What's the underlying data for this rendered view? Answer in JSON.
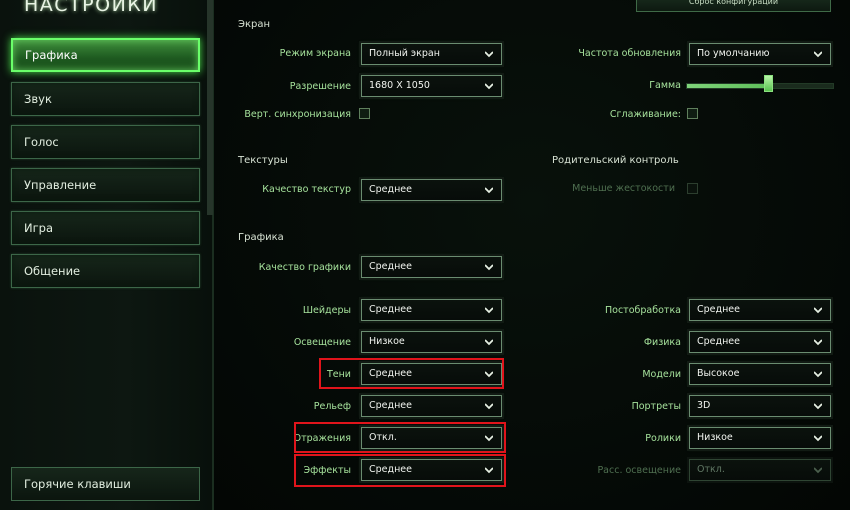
{
  "app": {
    "title": "НАСТРОЙКИ"
  },
  "nav": {
    "items": [
      {
        "label": "Графика",
        "active": true
      },
      {
        "label": "Звук"
      },
      {
        "label": "Голос"
      },
      {
        "label": "Управление"
      },
      {
        "label": "Игра"
      },
      {
        "label": "Общение"
      }
    ],
    "hotkeys_label": "Горячие клавиши"
  },
  "top_button": {
    "label": "Сброс конфигурации"
  },
  "screen": {
    "heading": "Экран",
    "mode_label": "Режим экрана",
    "mode_value": "Полный экран",
    "resolution_label": "Разрешение",
    "resolution_value": "1680 X 1050",
    "vsync_label": "Верт. синхронизация",
    "refresh_label": "Частота обновления",
    "refresh_value": "По умолчанию",
    "gamma_label": "Гамма",
    "gamma_level": 0.55,
    "smoothing_label": "Сглаживание:"
  },
  "textures": {
    "heading": "Текстуры",
    "quality_label": "Качество текстур",
    "quality_value": "Среднее"
  },
  "parental": {
    "heading": "Родительский контроль",
    "less_gore_label": "Меньше жестокости"
  },
  "graphics": {
    "heading": "Графика",
    "quality_label": "Качество графики",
    "quality_value": "Среднее",
    "shaders_label": "Шейдеры",
    "shaders_value": "Среднее",
    "lighting_label": "Освещение",
    "lighting_value": "Низкое",
    "shadows_label": "Тени",
    "shadows_value": "Среднее",
    "terrain_label": "Рельеф",
    "terrain_value": "Среднее",
    "reflections_label": "Отражения",
    "reflections_value": "Откл.",
    "effects_label": "Эффекты",
    "effects_value": "Среднее",
    "postprocess_label": "Постобработка",
    "postprocess_value": "Среднее",
    "physics_label": "Физика",
    "physics_value": "Среднее",
    "models_label": "Модели",
    "models_value": "Высокое",
    "portraits_label": "Портреты",
    "portraits_value": "3D",
    "movies_label": "Ролики",
    "movies_value": "Низкое",
    "indirect_label": "Расс. освещение",
    "indirect_value": "Откл."
  },
  "colors": {
    "accent": "#6aff6a",
    "highlight_box": "#e0141b",
    "label": "#a6e29c"
  }
}
